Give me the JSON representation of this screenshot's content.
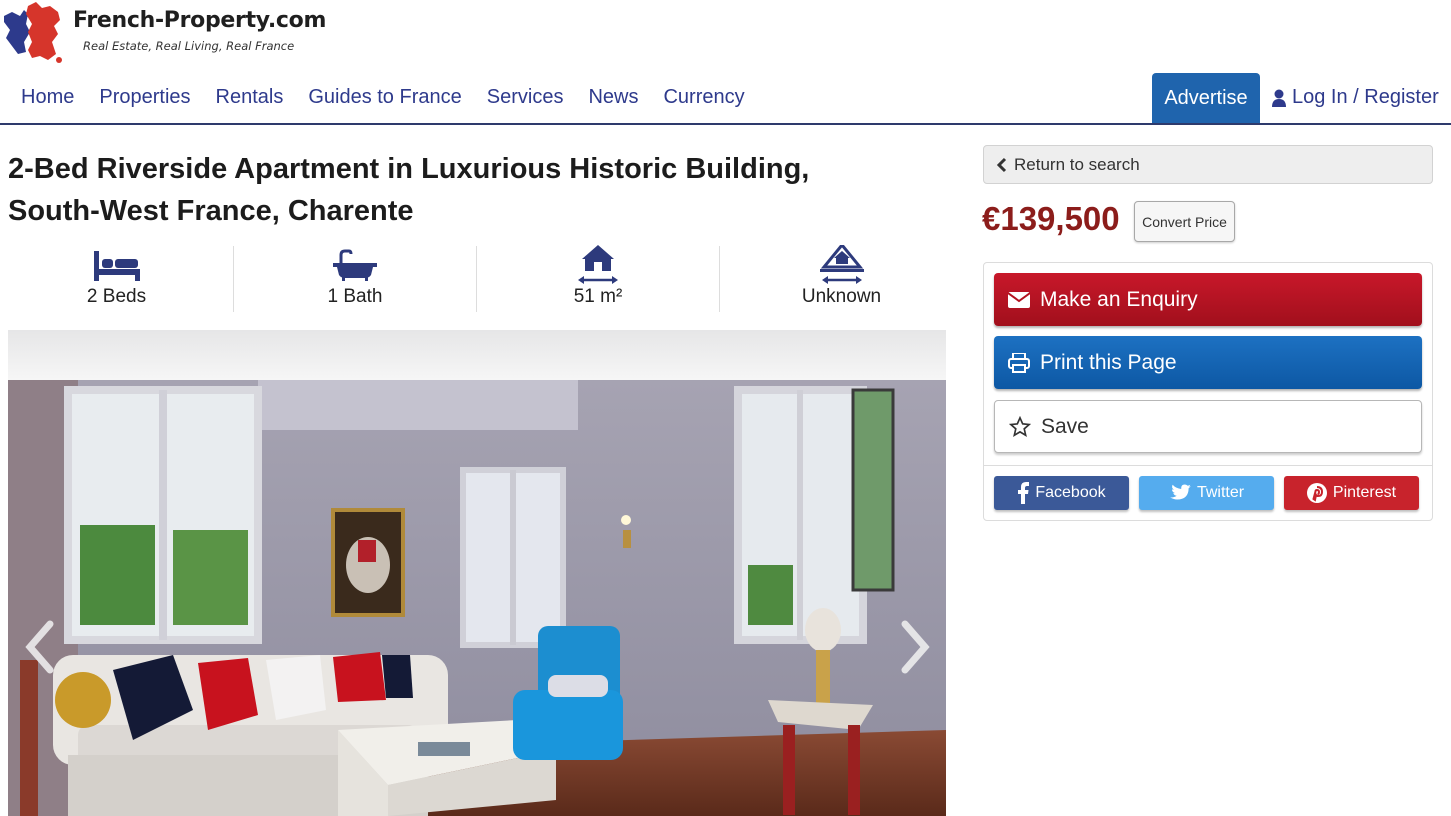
{
  "site": {
    "name": "French-Property.com",
    "tagline": "Real Estate, Real Living, Real France"
  },
  "nav": {
    "items": [
      "Home",
      "Properties",
      "Rentals",
      "Guides to France",
      "Services",
      "News",
      "Currency"
    ],
    "advertise": "Advertise",
    "login": "Log In / Register"
  },
  "listing": {
    "title": "2-Bed Riverside Apartment in Luxurious Historic Building, South-West France, Charente",
    "stats": [
      {
        "icon": "bed-icon",
        "label": "2 Beds"
      },
      {
        "icon": "bath-icon",
        "label": "1 Bath"
      },
      {
        "icon": "house-area-icon",
        "label": "51 m²"
      },
      {
        "icon": "land-area-icon",
        "label": "Unknown"
      }
    ],
    "price": "€139,500"
  },
  "sidebar": {
    "return_label": "Return to search",
    "convert_label": "Convert Price",
    "enquiry_label": "Make an Enquiry",
    "print_label": "Print this Page",
    "save_label": "Save",
    "social": {
      "facebook": "Facebook",
      "twitter": "Twitter",
      "pinterest": "Pinterest"
    }
  },
  "colors": {
    "brand_blue": "#2e3a8c",
    "advertise_bg": "#1f64ad",
    "price": "#8c1d1b",
    "enquiry": "#b3121f",
    "print": "#1565b5",
    "facebook": "#3b5998",
    "twitter": "#55acee",
    "pinterest": "#c8232c"
  }
}
